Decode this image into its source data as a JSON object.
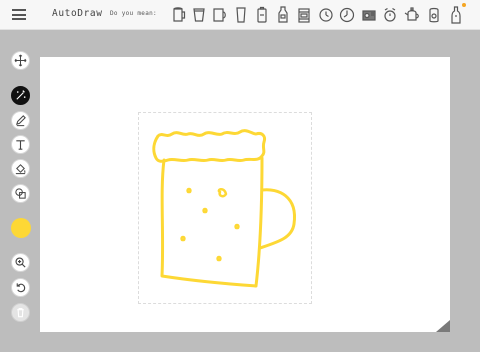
{
  "header": {
    "title": "AutoDraw",
    "did_you_mean": "Do you mean:",
    "suggestions": [
      "mug-icon",
      "cup-icon",
      "mug-handle-icon",
      "glass-icon",
      "battery-icon",
      "ketchup-bottle-icon",
      "film-canister-icon",
      "clock-icon",
      "clock-icon",
      "radio-icon",
      "alarm-clock-icon",
      "teapot-icon",
      "jar-icon",
      "bottle-icon"
    ]
  },
  "toolbar": {
    "tools": [
      "move",
      "autodraw",
      "draw",
      "type",
      "fill",
      "shape",
      "color",
      "zoom",
      "undo",
      "delete"
    ],
    "active": "autodraw",
    "color": "#fdd835"
  },
  "canvas": {
    "drawing": "beer mug doodle",
    "stroke_color": "#fdd835",
    "background": "#ffffff"
  }
}
